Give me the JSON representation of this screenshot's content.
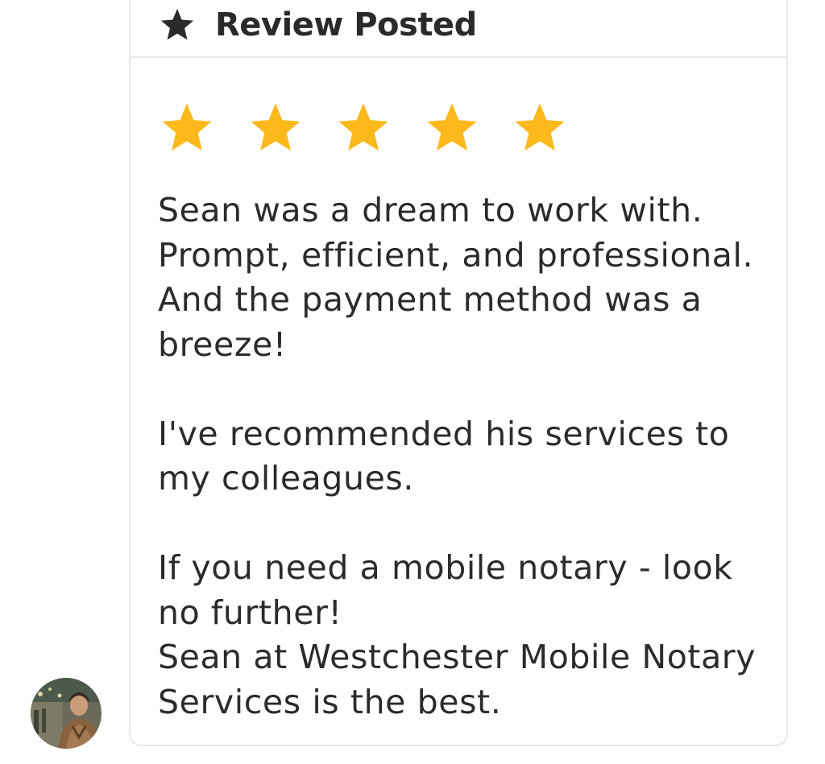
{
  "card": {
    "title": "Review Posted",
    "rating": {
      "value": 5,
      "max": 5,
      "star_color": "#FDB91B"
    },
    "review_lines": [
      "Sean was a dream to work with.",
      "Prompt, efficient, and professional.",
      "And the payment method was a",
      "breeze!",
      "",
      "I've recommended his services to",
      "my colleagues.",
      "",
      "If you need a mobile notary - look",
      "no further!",
      "Sean at Westchester Mobile Notary",
      "Services is the best."
    ]
  },
  "icons": {
    "header": "star-icon",
    "avatar": "user-avatar-photo"
  }
}
